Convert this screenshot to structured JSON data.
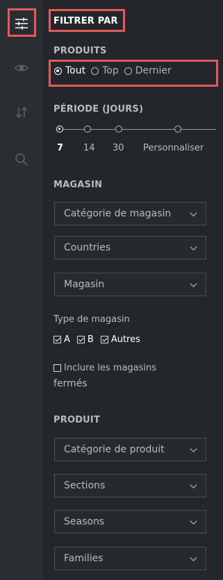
{
  "rail": {
    "icons": [
      "filter-sliders-icon",
      "eye-icon",
      "sort-icon",
      "search-icon"
    ]
  },
  "panel": {
    "title": "FILTRER PAR",
    "products": {
      "label": "PRODUITS",
      "options": [
        "Tout",
        "Top",
        "Dernier"
      ],
      "selected": "Tout"
    },
    "period": {
      "label": "PÉRIODE (JOURS)",
      "ticks": [
        "7",
        "14",
        "30",
        "Personnaliser"
      ],
      "selected": "7"
    },
    "store": {
      "label": "MAGASIN",
      "selects": [
        "Catégorie de magasin",
        "Countries",
        "Magasin"
      ],
      "type_label": "Type de magasin",
      "types": [
        {
          "label": "A",
          "checked": true
        },
        {
          "label": "B",
          "checked": true
        },
        {
          "label": "Autres",
          "checked": true
        }
      ],
      "include_closed_line1": "Inclure les magasins",
      "include_closed_line2": "fermés",
      "include_closed_checked": false
    },
    "product": {
      "label": "PRODUIT",
      "selects": [
        "Catégorie de produit",
        "Sections",
        "Seasons",
        "Families"
      ]
    }
  },
  "colors": {
    "background": "#23272b",
    "rail": "#2a2e33",
    "highlight": "#e65a5a"
  }
}
